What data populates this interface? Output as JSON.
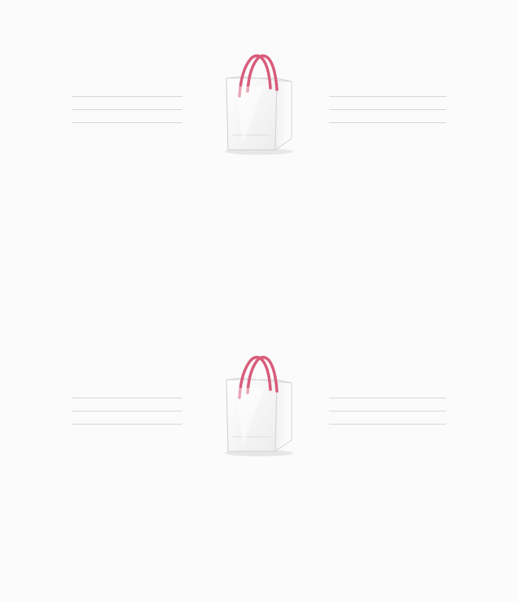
{
  "empty_state": {
    "placeholders": [
      {
        "icon": "shopping-bag-icon",
        "handle_color": "#d85c7a"
      },
      {
        "icon": "shopping-bag-icon",
        "handle_color": "#d85c7a"
      }
    ]
  }
}
